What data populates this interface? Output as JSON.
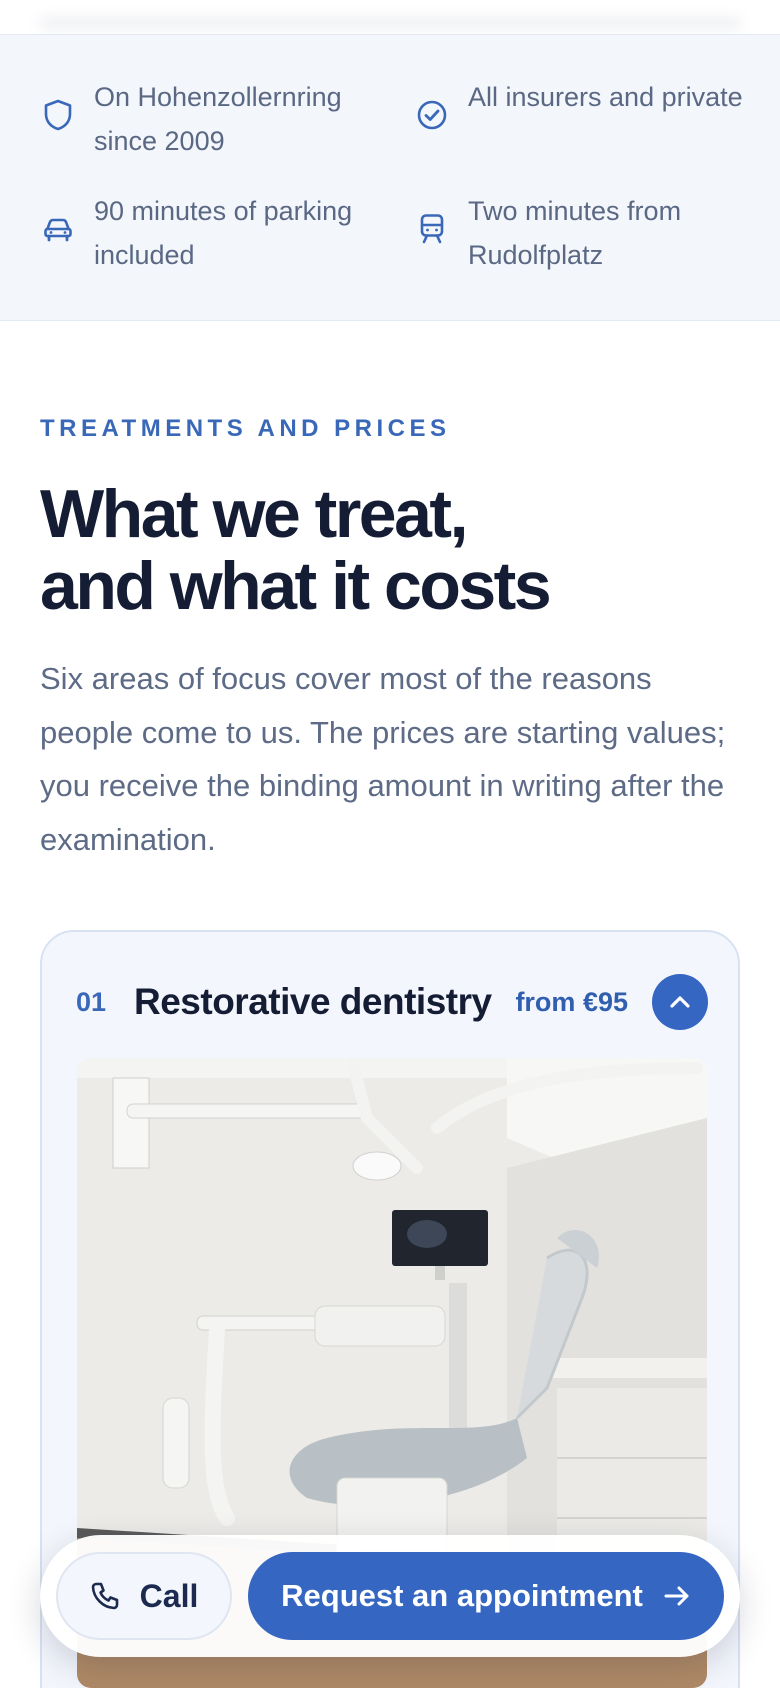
{
  "features": [
    {
      "icon": "shield-icon",
      "text": "On Hohenzollernring since 2009"
    },
    {
      "icon": "check-circle-icon",
      "text": "All insurers and private"
    },
    {
      "icon": "car-icon",
      "text": "90 minutes of parking included"
    },
    {
      "icon": "tram-icon",
      "text": "Two minutes from Rudolfplatz"
    }
  ],
  "section": {
    "eyebrow": "TREATMENTS AND PRICES",
    "heading_line1": "What we treat,",
    "heading_line2": "and what it costs",
    "intro": "Six areas of focus cover most of the reasons people come to us. The prices are starting values; you receive the binding amount in writing after the examination."
  },
  "card": {
    "number": "01",
    "title": "Restorative dentistry",
    "price": "from €95",
    "toggle_icon": "chevron-up-icon",
    "image_description": "dental treatment room"
  },
  "actions": {
    "call_label": "Call",
    "call_icon": "phone-icon",
    "request_label": "Request an appointment",
    "request_icon": "arrow-right-icon"
  },
  "colors": {
    "accent": "#3566c2",
    "heading": "#151d35",
    "muted_text": "#5d6b86",
    "panel_bg": "#f3f6fb"
  }
}
